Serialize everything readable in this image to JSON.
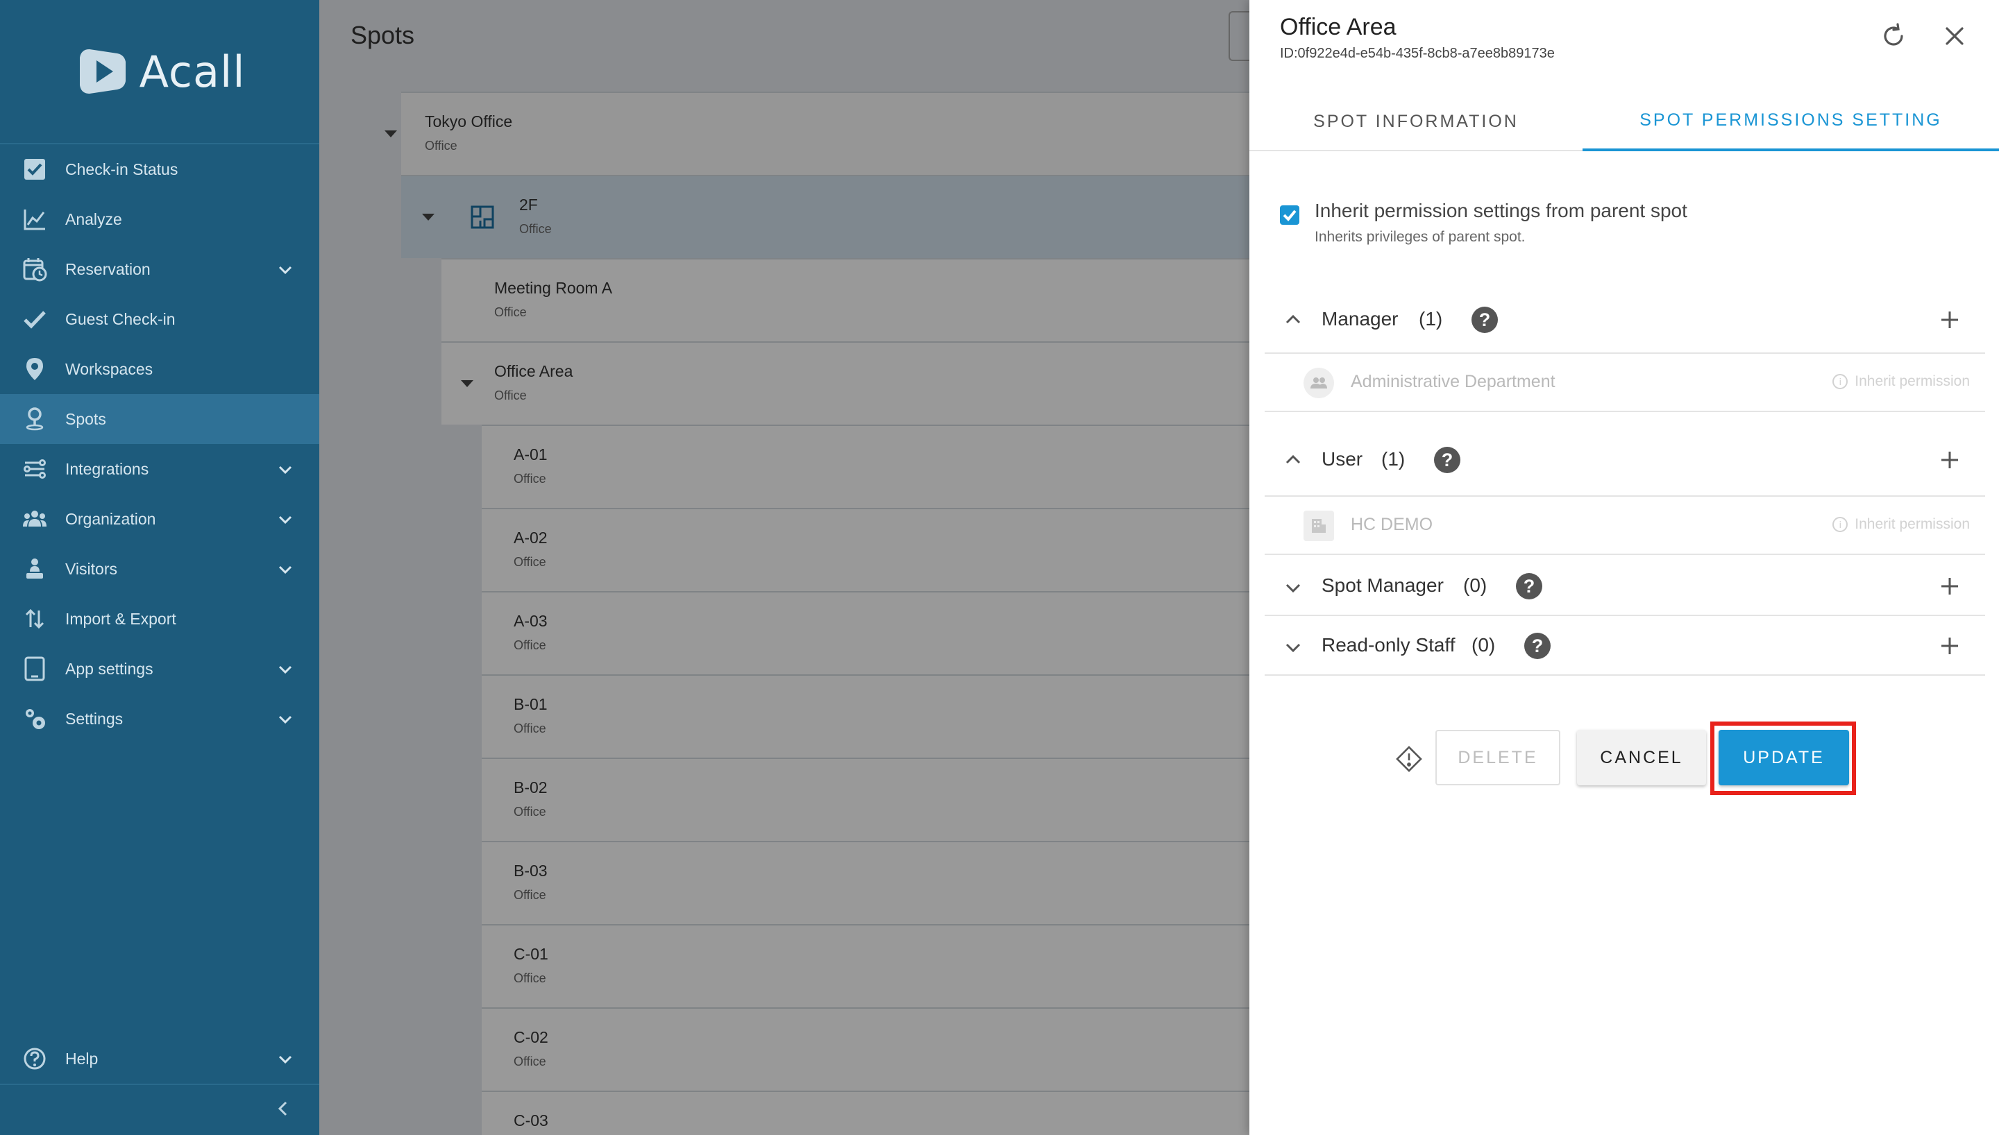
{
  "app": {
    "brand": "Acall"
  },
  "sidebar": {
    "items": [
      {
        "label": "Check-in Status",
        "icon": "checkbox-icon",
        "expandable": false
      },
      {
        "label": "Analyze",
        "icon": "chart-line-icon",
        "expandable": false
      },
      {
        "label": "Reservation",
        "icon": "calendar-clock-icon",
        "expandable": true
      },
      {
        "label": "Guest Check-in",
        "icon": "checkmark-icon",
        "expandable": false
      },
      {
        "label": "Workspaces",
        "icon": "map-pin-icon",
        "expandable": false
      },
      {
        "label": "Spots",
        "icon": "person-pin-icon",
        "expandable": false,
        "active": true
      },
      {
        "label": "Integrations",
        "icon": "integrations-icon",
        "expandable": true
      },
      {
        "label": "Organization",
        "icon": "people-icon",
        "expandable": true
      },
      {
        "label": "Visitors",
        "icon": "visitor-icon",
        "expandable": true
      },
      {
        "label": "Import & Export",
        "icon": "import-export-icon",
        "expandable": false
      },
      {
        "label": "App settings",
        "icon": "tablet-icon",
        "expandable": true
      },
      {
        "label": "Settings",
        "icon": "gears-icon",
        "expandable": true
      }
    ],
    "help": {
      "label": "Help",
      "icon": "help-circle-icon"
    }
  },
  "main": {
    "title": "Spots",
    "tree": [
      {
        "name": "Tokyo Office",
        "type": "Office",
        "level": 0,
        "caret": true
      },
      {
        "name": "2F",
        "type": "Office",
        "level": 1,
        "caret": true,
        "floor_icon": true
      },
      {
        "name": "Meeting Room A",
        "type": "Office",
        "level": 2,
        "caret": false
      },
      {
        "name": "Office Area",
        "type": "Office",
        "level": 2,
        "caret": true
      },
      {
        "name": "A-01",
        "type": "Office",
        "level": 3,
        "caret": false
      },
      {
        "name": "A-02",
        "type": "Office",
        "level": 3,
        "caret": false
      },
      {
        "name": "A-03",
        "type": "Office",
        "level": 3,
        "caret": false
      },
      {
        "name": "B-01",
        "type": "Office",
        "level": 3,
        "caret": false
      },
      {
        "name": "B-02",
        "type": "Office",
        "level": 3,
        "caret": false
      },
      {
        "name": "B-03",
        "type": "Office",
        "level": 3,
        "caret": false
      },
      {
        "name": "C-01",
        "type": "Office",
        "level": 3,
        "caret": false
      },
      {
        "name": "C-02",
        "type": "Office",
        "level": 3,
        "caret": false
      },
      {
        "name": "C-03",
        "type": "Office",
        "level": 3,
        "caret": false
      }
    ]
  },
  "panel": {
    "title": "Office Area",
    "id_text": "ID:0f922e4d-e54b-435f-8cb8-a7ee8b89173e",
    "tabs": [
      {
        "label": "SPOT INFORMATION",
        "active": false
      },
      {
        "label": "SPOT PERMISSIONS SETTING",
        "active": true
      }
    ],
    "inherit": {
      "checked": true,
      "label": "Inherit permission settings from parent spot",
      "sub": "Inherits privileges of parent spot."
    },
    "sections": [
      {
        "label": "Manager",
        "count": "(1)",
        "expanded": true,
        "members": [
          {
            "name": "Administrative Department",
            "icon": "group-icon",
            "inherit_label": "Inherit permission"
          }
        ]
      },
      {
        "label": "User",
        "count": "(1)",
        "expanded": true,
        "members": [
          {
            "name": "HC DEMO",
            "icon": "building-icon",
            "inherit_label": "Inherit permission"
          }
        ]
      },
      {
        "label": "Spot Manager",
        "count": "(0)",
        "expanded": false,
        "members": []
      },
      {
        "label": "Read-only Staff",
        "count": "(0)",
        "expanded": false,
        "members": []
      }
    ],
    "buttons": {
      "delete": "DELETE",
      "cancel": "CANCEL",
      "update": "UPDATE"
    }
  },
  "colors": {
    "sidebar_bg": "#1d5b7c",
    "sidebar_active": "#2f7196",
    "accent": "#1a95d4",
    "highlight": "#e8221b"
  }
}
